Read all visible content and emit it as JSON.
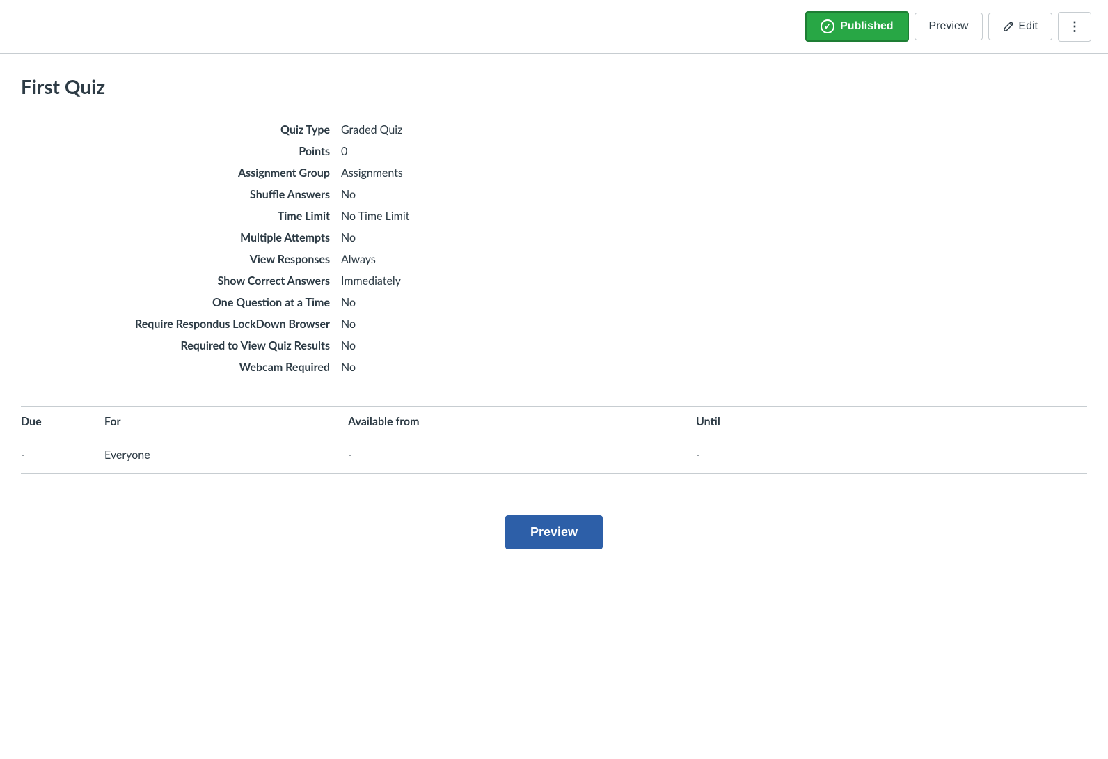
{
  "toolbar": {
    "published_label": "Published",
    "preview_label": "Preview",
    "edit_label": "Edit",
    "more_label": "⋮"
  },
  "page": {
    "title": "First Quiz"
  },
  "details": [
    {
      "label": "Quiz Type",
      "value": "Graded Quiz"
    },
    {
      "label": "Points",
      "value": "0"
    },
    {
      "label": "Assignment Group",
      "value": "Assignments"
    },
    {
      "label": "Shuffle Answers",
      "value": "No"
    },
    {
      "label": "Time Limit",
      "value": "No Time Limit"
    },
    {
      "label": "Multiple Attempts",
      "value": "No"
    },
    {
      "label": "View Responses",
      "value": "Always"
    },
    {
      "label": "Show Correct Answers",
      "value": "Immediately"
    },
    {
      "label": "One Question at a Time",
      "value": "No"
    },
    {
      "label": "Require Respondus LockDown Browser",
      "value": "No"
    },
    {
      "label": "Required to View Quiz Results",
      "value": "No"
    },
    {
      "label": "Webcam Required",
      "value": "No"
    }
  ],
  "availability_table": {
    "columns": [
      "Due",
      "For",
      "Available from",
      "Until"
    ],
    "rows": [
      {
        "due": "-",
        "for": "Everyone",
        "available_from": "-",
        "until": "-"
      }
    ]
  },
  "bottom_preview_label": "Preview"
}
